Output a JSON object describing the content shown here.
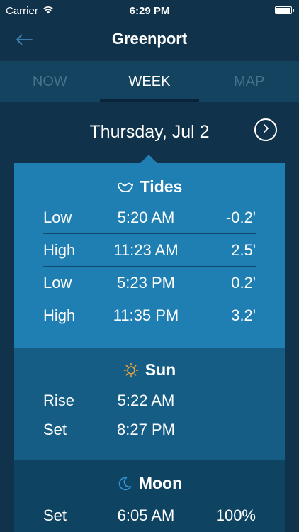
{
  "status_bar": {
    "carrier": "Carrier",
    "time": "6:29 PM",
    "battery_percent": 100
  },
  "nav": {
    "title": "Greenport",
    "back_icon": "back-arrow-icon"
  },
  "tabs": [
    {
      "label": "NOW",
      "active": false
    },
    {
      "label": "WEEK",
      "active": true
    },
    {
      "label": "MAP",
      "active": false
    }
  ],
  "date": {
    "label": "Thursday, Jul 2"
  },
  "tides": {
    "title": "Tides",
    "icon": "tide-icon",
    "rows": [
      {
        "type": "Low",
        "time": "5:20 AM",
        "height": "-0.2'"
      },
      {
        "type": "High",
        "time": "11:23 AM",
        "height": "2.5'"
      },
      {
        "type": "Low",
        "time": "5:23 PM",
        "height": "0.2'"
      },
      {
        "type": "High",
        "time": "11:35 PM",
        "height": "3.2'"
      }
    ]
  },
  "sun": {
    "title": "Sun",
    "icon": "sun-icon",
    "rows": [
      {
        "label": "Rise",
        "time": "5:22 AM"
      },
      {
        "label": "Set",
        "time": "8:27 PM"
      }
    ]
  },
  "moon": {
    "title": "Moon",
    "icon": "moon-icon",
    "rows": [
      {
        "label": "Set",
        "time": "6:05 AM",
        "illumination": "100%"
      }
    ]
  },
  "colors": {
    "background": "#10324a",
    "tab_bar": "#14435f",
    "tides_bg": "#1f7fb3",
    "sun_bg": "#155d84",
    "moon_bg": "#0f4362",
    "sun_icon": "#f0a33a",
    "moon_icon": "#2f95d6"
  }
}
